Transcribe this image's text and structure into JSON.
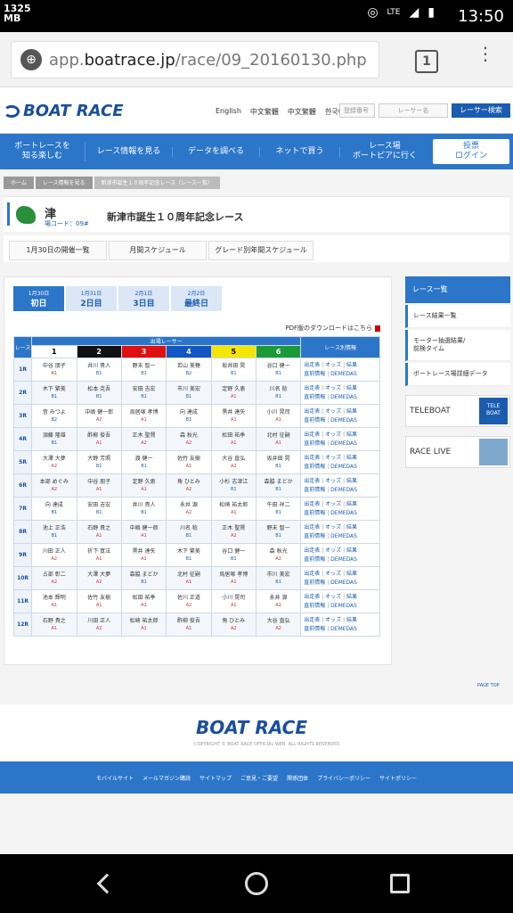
{
  "status": {
    "mb": "1325",
    "mb_unit": "MB",
    "lte": "LTE",
    "time": "13:50"
  },
  "browser": {
    "url_prefix": "app.",
    "url_host": "boatrace.jp",
    "url_path": "/race/09_20160130.php",
    "tabs": "1"
  },
  "header": {
    "logo": "BOAT RACE",
    "langs": [
      "English",
      "中文繁體",
      "中文繁體",
      "한국어"
    ],
    "reg_placeholder": "登録番号",
    "name_placeholder": "レーサー名",
    "racer_search": "レーサー検索"
  },
  "nav": {
    "items": [
      "ボートレースを\n知る楽しむ",
      "レース情報を見る",
      "データを調べる",
      "ネットで買う",
      "レース場\nボートピアに行く"
    ],
    "login": "投票\nログイン"
  },
  "breadcrumb": [
    "ホーム",
    "レース情報を見る",
    "新津市誕生１０周年記念レース（レース一覧）"
  ],
  "venue": {
    "name": "津",
    "code": "場コード：09#",
    "title": "新津市誕生１０周年記念レース"
  },
  "subtabs": [
    "1月30日の開催一覧",
    "月間スケジュール",
    "グレード別年間スケジュール"
  ],
  "days": [
    {
      "date": "1月30日",
      "label": "初日"
    },
    {
      "date": "1月31日",
      "label": "2日目"
    },
    {
      "date": "2月1日",
      "label": "3日目"
    },
    {
      "date": "2月2日",
      "label": "最終日"
    }
  ],
  "pdf": "PDF版のダウンロードはこちら",
  "table": {
    "race_col": "レース",
    "racers_header": "出場レーサー",
    "info_header": "レース別情報",
    "lanes": [
      "1",
      "2",
      "3",
      "4",
      "5",
      "6"
    ],
    "links": {
      "a": "出走表",
      "b": "オッズ",
      "c": "結果",
      "d": "直前情報",
      "e": "DEMEDAS"
    },
    "rows": [
      {
        "r": "1R",
        "p": [
          [
            "中谷 朋子",
            "A1"
          ],
          [
            "井川 貴人",
            "B1"
          ],
          [
            "野末 智一",
            "B1"
          ],
          [
            "若山 美穂",
            "B2"
          ],
          [
            "坂井田 晃",
            "B1"
          ],
          [
            "谷口 健一",
            "B1"
          ]
        ]
      },
      {
        "r": "2R",
        "p": [
          [
            "木下 繁美",
            "B1"
          ],
          [
            "松本 克吾",
            "B1"
          ],
          [
            "安田 吉宏",
            "B1"
          ],
          [
            "市川 美宏",
            "B1"
          ],
          [
            "定野 久恵",
            "A1"
          ],
          [
            "川名 稔",
            "B1"
          ]
        ]
      },
      {
        "r": "3R",
        "p": [
          [
            "音 みつよ",
            "B2"
          ],
          [
            "中嶋 健一郎",
            "A2"
          ],
          [
            "烏居塚 孝博",
            "A1"
          ],
          [
            "向 達成",
            "B1"
          ],
          [
            "黒井 達矢",
            "A1"
          ],
          [
            "小川 晃司",
            "A1"
          ]
        ]
      },
      {
        "r": "4R",
        "p": [
          [
            "須藤 隆雄",
            "B1"
          ],
          [
            "酢柳 俊吾",
            "A1"
          ],
          [
            "正木 聖賢",
            "A2"
          ],
          [
            "森 秋光",
            "A2"
          ],
          [
            "松田 祐季",
            "A1"
          ],
          [
            "北村 征嗣",
            "A1"
          ]
        ]
      },
      {
        "r": "5R",
        "p": [
          [
            "大澤 大夢",
            "A2"
          ],
          [
            "大野 芳照",
            "B1"
          ],
          [
            "渡 健一",
            "B1"
          ],
          [
            "佐竹 友樹",
            "A1"
          ],
          [
            "大谷 直弘",
            "A2"
          ],
          [
            "坂井田 晃",
            "B1"
          ]
        ]
      },
      {
        "r": "6R",
        "p": [
          [
            "本部 めぐみ",
            "A2"
          ],
          [
            "中谷 朋子",
            "A1"
          ],
          [
            "定野 久恵",
            "A1"
          ],
          [
            "角 ひとみ",
            "A2"
          ],
          [
            "小杉 志津江",
            "B1"
          ],
          [
            "森脇 まどか",
            "B1"
          ]
        ]
      },
      {
        "r": "7R",
        "p": [
          [
            "向 達成",
            "B1"
          ],
          [
            "安田 吉宏",
            "B1"
          ],
          [
            "井川 貴人",
            "B1"
          ],
          [
            "永井 源",
            "A2"
          ],
          [
            "松崎 祐太郎",
            "A1"
          ],
          [
            "午田 祥二",
            "B1"
          ]
        ]
      },
      {
        "r": "8R",
        "p": [
          [
            "池上 正浩",
            "B1"
          ],
          [
            "石野 貴之",
            "A1"
          ],
          [
            "中嶋 健一郎",
            "A1"
          ],
          [
            "川名 稔",
            "B1"
          ],
          [
            "正木 聖賢",
            "A2"
          ],
          [
            "野末 智一",
            "B1"
          ]
        ]
      },
      {
        "r": "9R",
        "p": [
          [
            "川田 正人",
            "A2"
          ],
          [
            "折下 寛法",
            "A1"
          ],
          [
            "黒井 達矢",
            "A1"
          ],
          [
            "木下 繁美",
            "B1"
          ],
          [
            "谷口 健一",
            "B1"
          ],
          [
            "森 秋光",
            "A2"
          ]
        ]
      },
      {
        "r": "10R",
        "p": [
          [
            "占部 彰二",
            "A2"
          ],
          [
            "大澤 大夢",
            "A2"
          ],
          [
            "森脇 まどか",
            "B1"
          ],
          [
            "北村 征嗣",
            "A1"
          ],
          [
            "烏居塚 孝博",
            "A1"
          ],
          [
            "市川 美宏",
            "B1"
          ]
        ]
      },
      {
        "r": "11R",
        "p": [
          [
            "池本 輝明",
            "A1"
          ],
          [
            "佐竹 友樹",
            "A1"
          ],
          [
            "松田 祐季",
            "A1"
          ],
          [
            "佐川 正道",
            "A2"
          ],
          [
            "小川 晃司",
            "A1"
          ],
          [
            "永井 源",
            "A2"
          ]
        ]
      },
      {
        "r": "12R",
        "p": [
          [
            "石野 貴之",
            "A1"
          ],
          [
            "川田 正人",
            "A2"
          ],
          [
            "松崎 祐太郎",
            "A1"
          ],
          [
            "酢柳 俊吾",
            "A1"
          ],
          [
            "角 ひとみ",
            "A2"
          ],
          [
            "大谷 直弘",
            "A2"
          ]
        ]
      }
    ]
  },
  "side": {
    "header": "レース一覧",
    "items": [
      "レース結果一覧",
      "モーター抽選結果/\n前検タイム",
      "ボートレース場詳細データ"
    ],
    "teleboat": "TELEBOAT",
    "teleboat_badge": "TELE\nBOAT",
    "racelive": "RACE LIVE"
  },
  "pagetop": "PAGE TOP",
  "footer": {
    "logo": "BOAT RACE",
    "copyright": "COPYRIGHT © BOAT RACE OFFICIAL WEB. ALL RIGHTS RESERVED.",
    "links": [
      "モバイルサイト",
      "メールマガジン購読",
      "サイトマップ",
      "ご意見・ご要望",
      "関係団体",
      "プライバシーポリシー",
      "サイトポリシー"
    ]
  }
}
